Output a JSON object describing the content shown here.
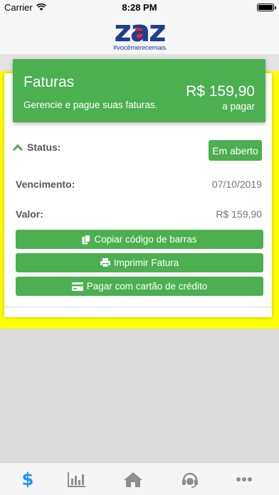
{
  "status_bar": {
    "carrier": "Carrier",
    "time": "8:28 PM"
  },
  "logo": {
    "word": "zaz",
    "tagline": "#vocêmerecemais"
  },
  "banner": {
    "title": "Faturas",
    "subtitle": "Gerencie e pague suas faturas.",
    "amount": "R$ 159,90",
    "amount_caption": "a pagar"
  },
  "invoice": {
    "status_label": "Status:",
    "status_value": "Em aberto",
    "due_label": "Vencimento:",
    "due_value": "07/10/2019",
    "value_label": "Valor:",
    "value_amount": "R$ 159,90"
  },
  "actions": {
    "copy_barcode": "Copiar código de barras",
    "print_invoice": "Imprimir Fatura",
    "pay_card": "Pagar com cartão de crédito"
  },
  "tabs": [
    {
      "icon": "dollar-icon",
      "active": true
    },
    {
      "icon": "bar-chart-icon",
      "active": false
    },
    {
      "icon": "home-icon",
      "active": false
    },
    {
      "icon": "headset-icon",
      "active": false
    },
    {
      "icon": "more-icon",
      "active": false
    }
  ],
  "colors": {
    "accent": "#4caf50",
    "tab_active": "#1e90ff",
    "tab_inactive": "#8e8e8e",
    "highlight": "#ffff00"
  }
}
